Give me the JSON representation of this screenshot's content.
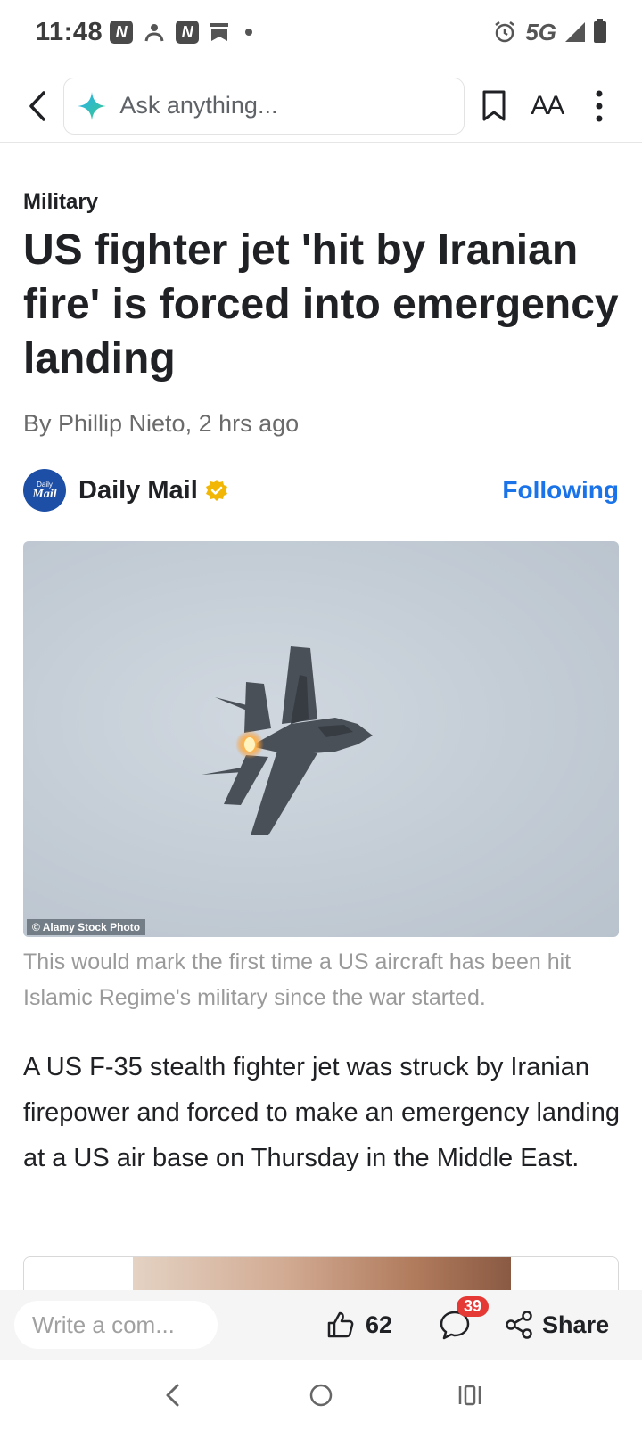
{
  "status_bar": {
    "time": "11:48",
    "network": "5G",
    "icons": [
      "notification-n-icon",
      "person-icon",
      "notification-n-icon",
      "bookmark-icon",
      "dot-icon",
      "alarm-icon",
      "signal-icon",
      "battery-icon"
    ]
  },
  "toolbar": {
    "search_placeholder": "Ask anything...",
    "font_size_label": "AA"
  },
  "article": {
    "category": "Military",
    "headline": "US fighter jet 'hit by Iranian fire' is forced into emergency landing",
    "byline": "By Phillip Nieto,  2 hrs ago",
    "source": {
      "logo_line1": "Daily",
      "logo_line2": "Mail",
      "name": "Daily Mail",
      "follow_state": "Following"
    },
    "image": {
      "credit": "© Alamy Stock Photo"
    },
    "caption": "This would mark the first time a US aircraft has been hit Islamic Regime's military since the war started.",
    "body": "A US F-35 stealth fighter jet was struck by Iranian firepower and forced to make an emergency landing at a US air base on Thursday in the Middle East."
  },
  "action_bar": {
    "comment_placeholder": "Write a com...",
    "like_count": "62",
    "comment_count": "39",
    "share_label": "Share"
  },
  "colors": {
    "accent": "#1a73e8",
    "badge": "#e53935",
    "verified": "#f2b705"
  }
}
